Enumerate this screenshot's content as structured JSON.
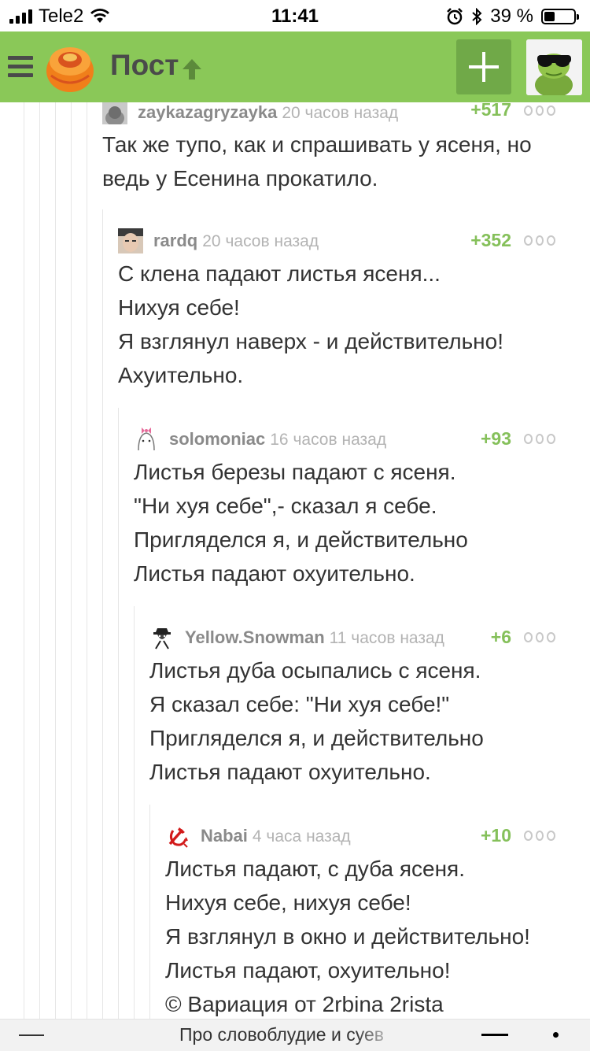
{
  "status_bar": {
    "carrier": "Tele2",
    "time": "11:41",
    "battery": "39 %",
    "battery_level": 0.39
  },
  "header": {
    "title": "Пост",
    "icons": [
      "menu-icon",
      "pikabu-logo",
      "arrow-up-icon",
      "plus-icon",
      "user-avatar"
    ]
  },
  "comments": [
    {
      "username": "zaykazagryzayka",
      "time": "20 часов назад",
      "rating": "+517",
      "lines": [
        "Так же тупо, как и спрашивать у ясеня, но",
        "ведь у Есенина прокатило."
      ]
    },
    {
      "username": "rardq",
      "time": "20 часов назад",
      "rating": "+352",
      "lines": [
        "С клена падают листья ясеня...",
        "Нихуя себе!",
        "Я взглянул наверх - и действительно!",
        "Ахуительно."
      ]
    },
    {
      "username": "solomoniac",
      "time": "16 часов назад",
      "rating": "+93",
      "lines": [
        "Листья березы падают с ясеня.",
        "\"Ни хуя себе\",- сказал я себе.",
        "Пригляделся я, и действительно",
        "Листья падают охуительно."
      ]
    },
    {
      "username": "Yellow.Snowman",
      "time": "11 часов назад",
      "rating": "+6",
      "lines": [
        "Листья дуба осыпались с ясеня.",
        "Я сказал себе: \"Ни хуя себе!\"",
        "Пригляделся я, и действительно",
        "Листья падают охуительно."
      ]
    },
    {
      "username": "Nabai",
      "time": "4 часа назад",
      "rating": "+10",
      "lines": [
        "Листья падают, с дуба ясеня.",
        "Нихуя себе, нихуя себе!",
        "Я взглянул в окно и действительно!",
        "Листья падают, охуительно!",
        "© Вариация от 2rbina 2rista"
      ]
    }
  ],
  "bottom_bar": {
    "post_title": "Про словоблудие и суев"
  },
  "colors": {
    "header_bg": "#8ac858",
    "plus_button_bg": "#70a948",
    "rating_green": "#85c05a",
    "username_gray": "#8a8a8a"
  }
}
